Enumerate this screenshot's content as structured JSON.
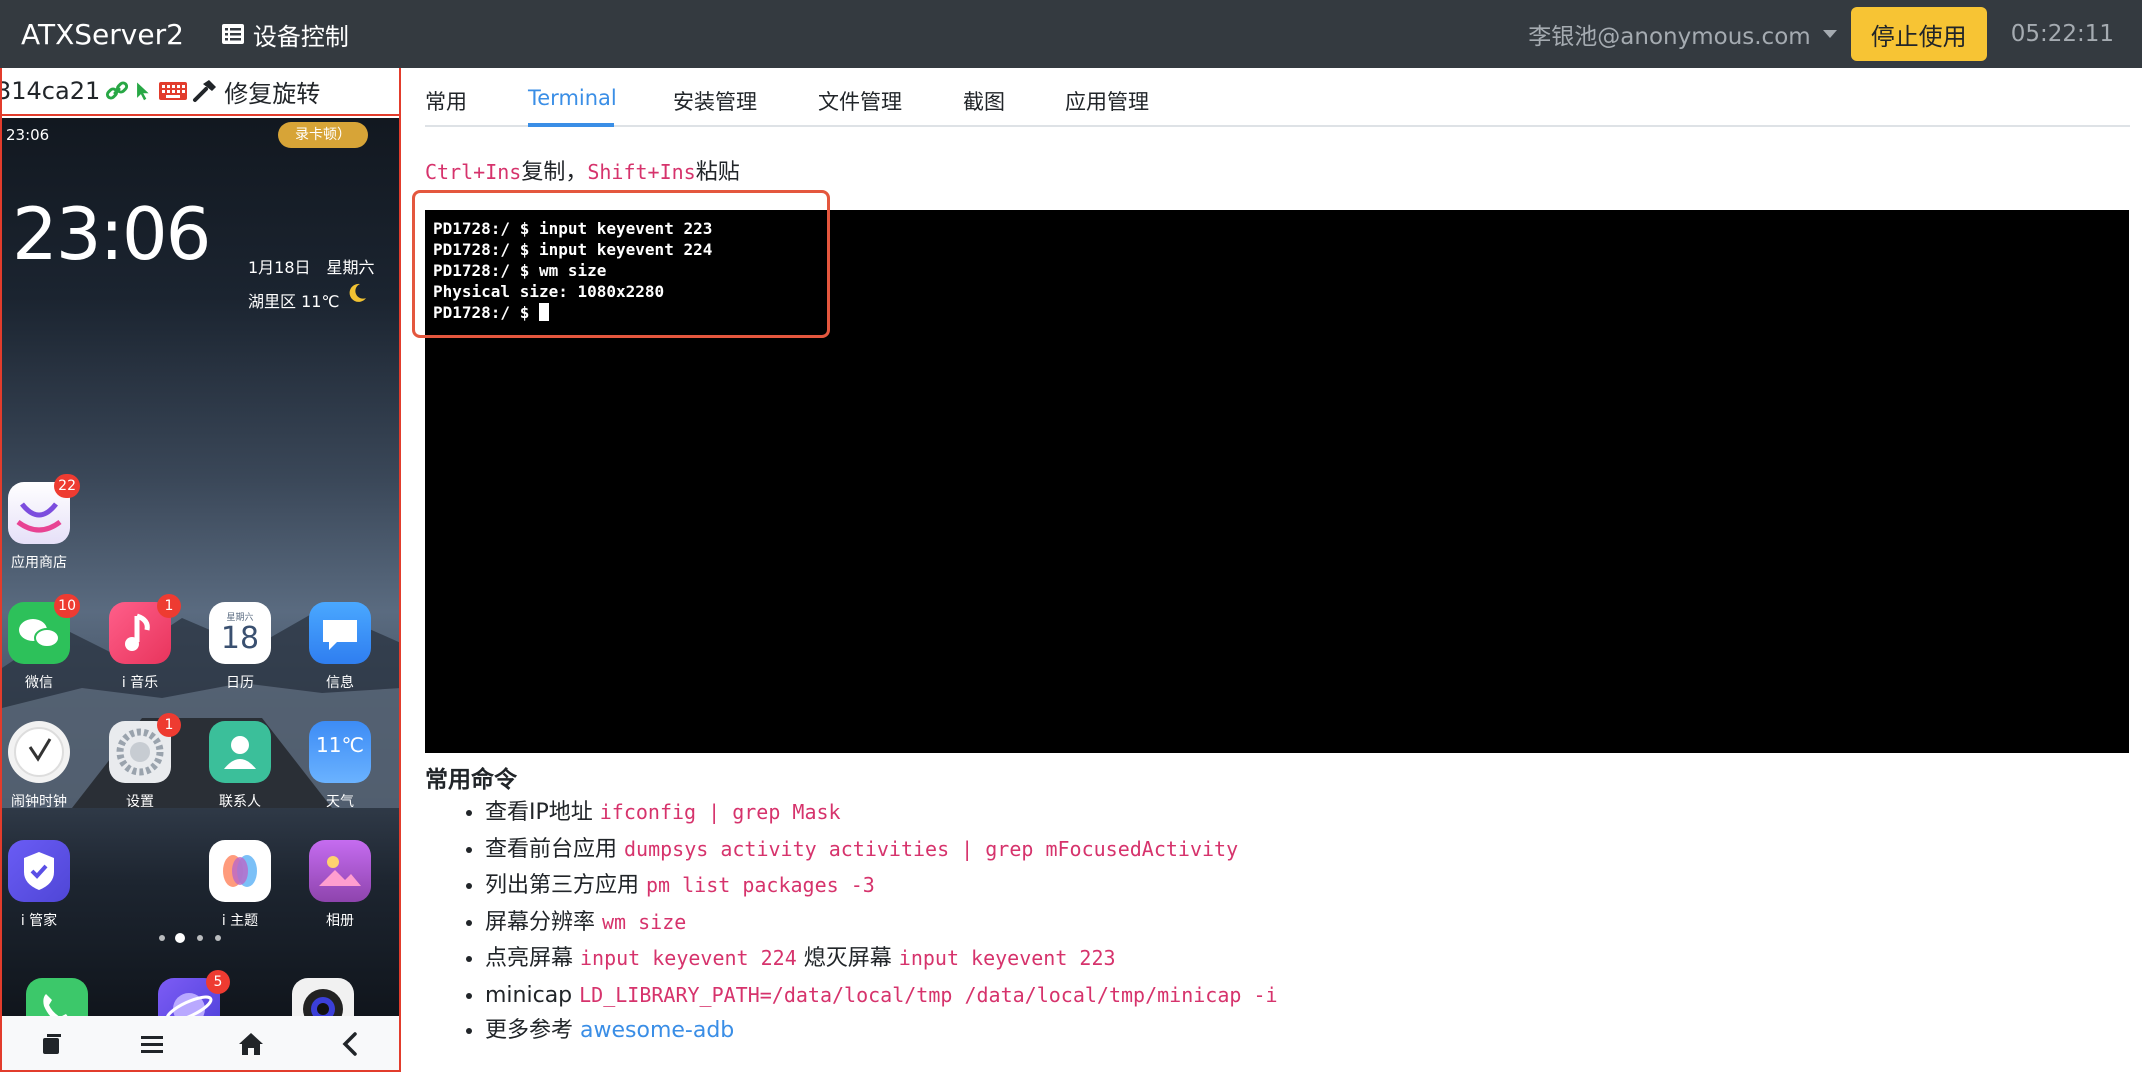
{
  "navbar": {
    "brand": "ATXServer2",
    "device_control": "设备控制",
    "user": "李银池@anonymous.com",
    "stop_button": "停止使用",
    "clock": "05:22:11"
  },
  "device": {
    "serial": "314ca21",
    "fix_rotation": "修复旋转"
  },
  "phone": {
    "status_time": "23:06",
    "status_pill": "录卡顿）",
    "clock": "23:06",
    "date": "1月18日　星期六",
    "weather": "湖里区 11℃",
    "apps": [
      {
        "label": "应用商店",
        "badge": "22",
        "icon": "app-store-icon"
      },
      {
        "label": "微信",
        "badge": "10",
        "icon": "wechat-icon"
      },
      {
        "label": "i 音乐",
        "badge": "1",
        "icon": "music-icon"
      },
      {
        "label": "日历",
        "badge": "",
        "icon": "calendar-icon",
        "day_name": "星期六",
        "day": "18"
      },
      {
        "label": "信息",
        "badge": "",
        "icon": "messages-icon"
      },
      {
        "label": "闹钟时钟",
        "badge": "",
        "icon": "alarm-clock-icon"
      },
      {
        "label": "设置",
        "badge": "1",
        "icon": "settings-icon"
      },
      {
        "label": "联系人",
        "badge": "",
        "icon": "contacts-icon"
      },
      {
        "label": "天气",
        "badge": "",
        "icon": "weather-icon",
        "temp": "11℃"
      },
      {
        "label": "i 管家",
        "badge": "",
        "icon": "manager-icon"
      },
      {
        "label": "i 主题",
        "badge": "",
        "icon": "theme-icon"
      },
      {
        "label": "相册",
        "badge": "",
        "icon": "gallery-icon"
      }
    ],
    "dock": [
      {
        "icon": "phone-icon",
        "badge": ""
      },
      {
        "icon": "browser-icon",
        "badge": "5"
      },
      {
        "icon": "camera-icon",
        "badge": ""
      }
    ]
  },
  "tabs": [
    {
      "label": "常用"
    },
    {
      "label": "Terminal"
    },
    {
      "label": "安装管理"
    },
    {
      "label": "文件管理"
    },
    {
      "label": "截图"
    },
    {
      "label": "应用管理"
    }
  ],
  "hint": {
    "copy_key": "Ctrl+Ins",
    "copy_text": "复制，",
    "paste_key": "Shift+Ins",
    "paste_text": "粘贴"
  },
  "terminal": {
    "lines": [
      "PD1728:/ $ input keyevent 223",
      "PD1728:/ $ input keyevent 224",
      "PD1728:/ $ wm size",
      "Physical size: 1080x2280",
      "PD1728:/ $ "
    ]
  },
  "commands": {
    "title": "常用命令",
    "items": [
      {
        "label": "查看IP地址",
        "code": "ifconfig | grep Mask"
      },
      {
        "label": "查看前台应用",
        "code": "dumpsys activity activities | grep mFocusedActivity"
      },
      {
        "label": "列出第三方应用",
        "code": "pm list packages -3"
      },
      {
        "label": "屏幕分辨率",
        "code": "wm size"
      },
      {
        "label": "点亮屏幕",
        "code": "input keyevent 224",
        "label2": "熄灭屏幕",
        "code2": "input keyevent 223"
      },
      {
        "label": "minicap",
        "code": "LD_LIBRARY_PATH=/data/local/tmp /data/local/tmp/minicap -i"
      },
      {
        "label": "更多参考",
        "link": "awesome-adb"
      }
    ]
  }
}
